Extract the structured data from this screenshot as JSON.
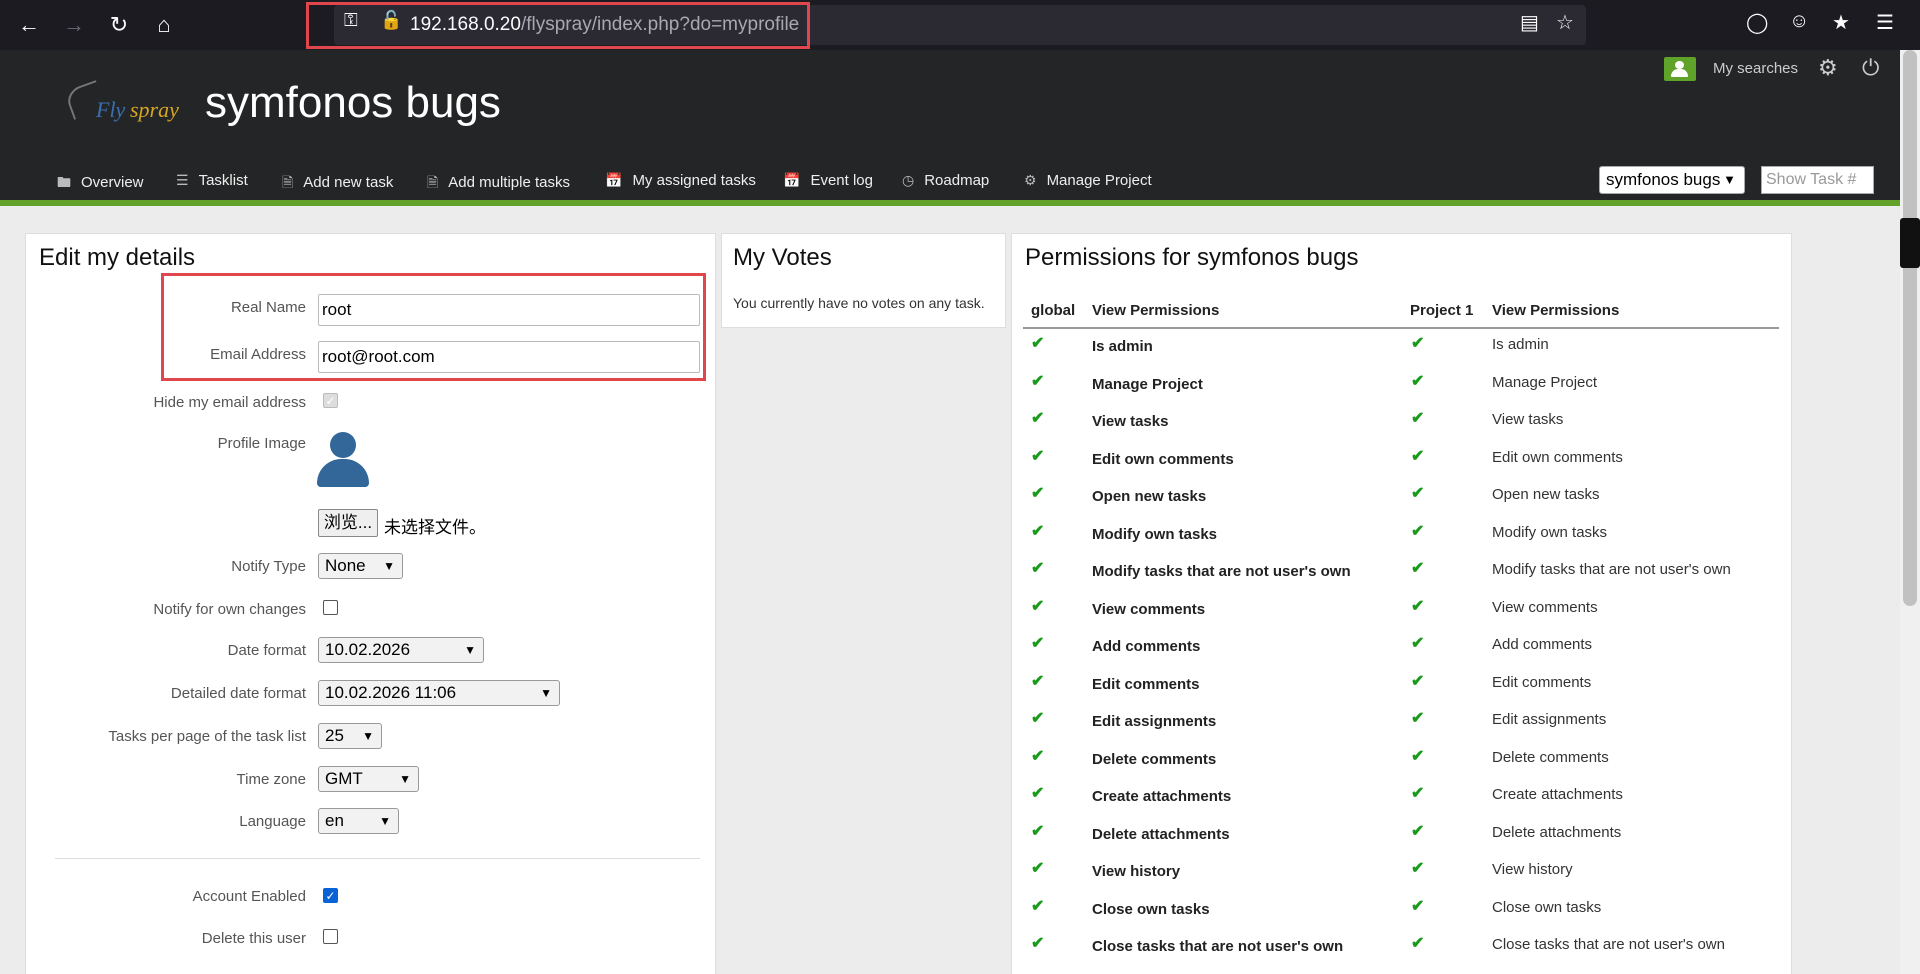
{
  "browser": {
    "url_host": "192.168.0.20",
    "url_path": "/flyspray/index.php?do=myprofile"
  },
  "header": {
    "logo_part1": "Fly",
    "logo_part2": "spray",
    "site_title": "symfonos bugs",
    "my_searches": "My searches"
  },
  "menu": {
    "items": [
      {
        "label": "Overview",
        "icon": "folder-icon"
      },
      {
        "label": "Tasklist",
        "icon": "list-icon"
      },
      {
        "label": "Add new task",
        "icon": "file-icon"
      },
      {
        "label": "Add multiple tasks",
        "icon": "file-icon"
      },
      {
        "label": "My assigned tasks",
        "icon": "calendar-icon"
      },
      {
        "label": "Event log",
        "icon": "calendar-icon"
      },
      {
        "label": "Roadmap",
        "icon": "dashboard-icon"
      },
      {
        "label": "Manage Project",
        "icon": "gear-icon"
      }
    ],
    "project_select": "symfonos bugs",
    "show_task_placeholder": "Show Task #"
  },
  "details": {
    "title": "Edit my details",
    "real_name_label": "Real Name",
    "real_name_value": "root",
    "email_label": "Email Address",
    "email_value": "root@root.com",
    "hide_email_label": "Hide my email address",
    "profile_image_label": "Profile Image",
    "file_button": "浏览...",
    "file_status": "未选择文件。",
    "notify_type_label": "Notify Type",
    "notify_type_value": "None",
    "notify_own_label": "Notify for own changes",
    "date_format_label": "Date format",
    "date_format_value": "10.02.2026",
    "detailed_date_label": "Detailed date format",
    "detailed_date_value": "10.02.2026 11:06",
    "tasks_per_page_label": "Tasks per page of the task list",
    "tasks_per_page_value": "25",
    "time_zone_label": "Time zone",
    "time_zone_value": "GMT",
    "language_label": "Language",
    "language_value": "en",
    "account_enabled_label": "Account Enabled",
    "delete_user_label": "Delete this user"
  },
  "votes": {
    "title": "My Votes",
    "text": "You currently have no votes on any task."
  },
  "permissions": {
    "title": "Permissions for symfonos bugs",
    "col_global": "global",
    "col_view1": "View Permissions",
    "col_project": "Project 1",
    "col_view2": "View Permissions",
    "rows": [
      "Is admin",
      "Manage Project",
      "View tasks",
      "Edit own comments",
      "Open new tasks",
      "Modify own tasks",
      "Modify tasks that are not user's own",
      "View comments",
      "Add comments",
      "Edit comments",
      "Edit assignments",
      "Delete comments",
      "Create attachments",
      "Delete attachments",
      "View history",
      "Close own tasks",
      "Close tasks that are not user's own"
    ]
  },
  "colors": {
    "accent_green": "#62a12a",
    "highlight_red": "#e0474c",
    "check_green": "#1a9a1a"
  }
}
